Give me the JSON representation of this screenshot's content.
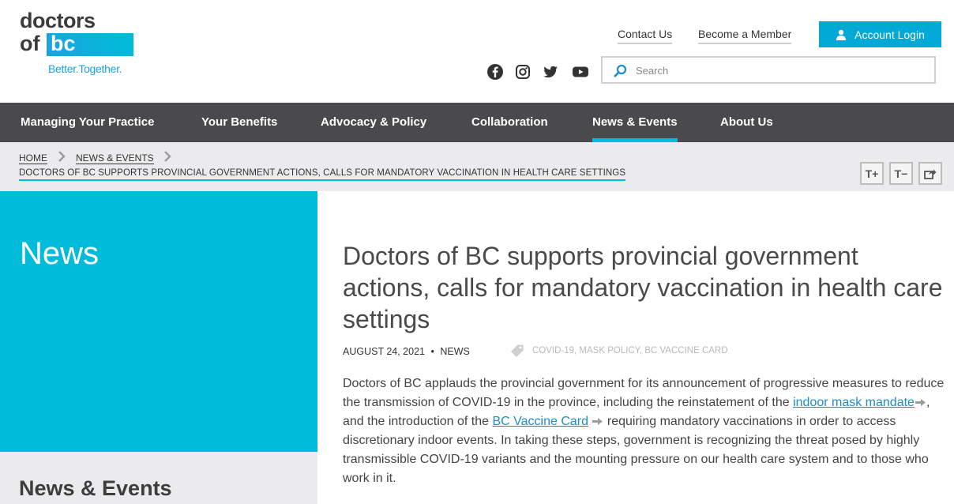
{
  "logo": {
    "line1": "doctors",
    "of": "of",
    "bc": "bc",
    "tagline": "Better.Together."
  },
  "header": {
    "contact_label": "Contact Us",
    "member_label": "Become a Member",
    "login_label": "Account Login",
    "search_placeholder": "Search"
  },
  "social": {
    "icons": [
      "facebook-icon",
      "instagram-icon",
      "twitter-icon",
      "youtube-icon"
    ]
  },
  "nav": {
    "items": [
      {
        "label": "Managing Your Practice"
      },
      {
        "label": "Your Benefits"
      },
      {
        "label": "Advocacy & Policy"
      },
      {
        "label": "Collaboration"
      },
      {
        "label": "News & Events"
      },
      {
        "label": "About Us"
      }
    ],
    "active": "News & Events"
  },
  "breadcrumb": {
    "home": "HOME",
    "news": "NEWS & EVENTS",
    "current": "DOCTORS OF BC SUPPORTS PROVINCIAL GOVERNMENT ACTIONS, CALLS FOR MANDATORY VACCINATION IN HEALTH CARE SETTINGS"
  },
  "tools": {
    "increase": "T+",
    "decrease": "T−"
  },
  "sidebar": {
    "title": "News",
    "section": "News & Events"
  },
  "article": {
    "title": "Doctors of BC supports provincial government actions, calls for mandatory vaccination in health care settings",
    "date": "AUGUST 24, 2021",
    "sep": "•",
    "category": "NEWS",
    "tags": "COVID-19, MASK POLICY, BC VACCINE CARD",
    "p1_a": "Doctors of BC applauds the provincial government for its announcement of progressive measures to reduce the transmission of COVID-19 in the province, including the reinstatement of the ",
    "link1": "indoor mask mandate",
    "p1_b": ", and the introduction of the ",
    "link2": "BC Vaccine Card",
    "p1_c": " requiring mandatory vaccinations in order to access discretionary indoor events. In taking these steps, government is recognizing the threat posed by highly transmissible COVID-19 variants and the mounting pressure on our health care system and to those who work in it."
  },
  "colors": {
    "accent": "#00bcd8",
    "button": "#00a9d6",
    "nav_bg": "#4a4a4c",
    "crumb_bg": "#ebebed",
    "link": "#1d8dc8"
  }
}
